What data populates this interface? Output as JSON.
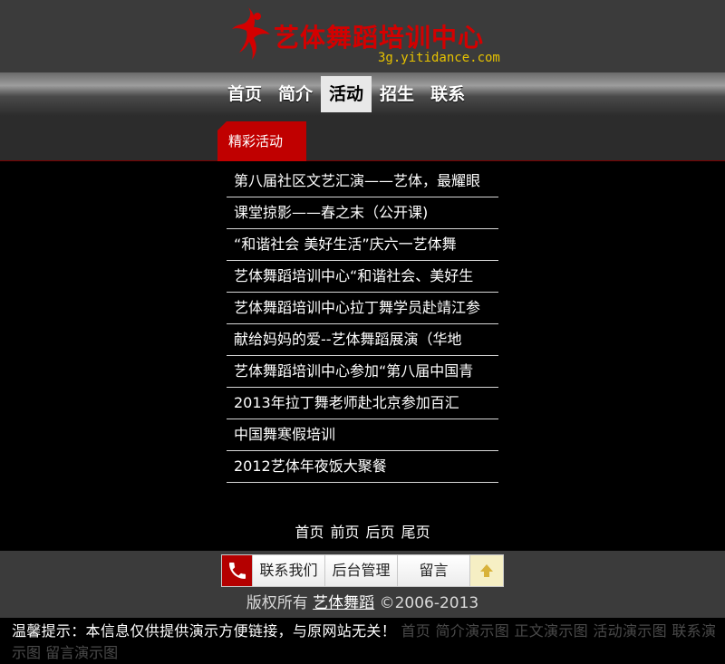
{
  "header": {
    "title": "艺体舞蹈培训中心",
    "url": "3g.yitidance.com"
  },
  "nav": {
    "items": [
      "首页",
      "简介",
      "活动",
      "招生",
      "联系"
    ],
    "active_index": 2
  },
  "section": {
    "title": "精彩活动"
  },
  "activities": [
    "第八届社区文艺汇演——艺体，最耀眼",
    "课堂掠影——春之末（公开课)",
    "“和谐社会 美好生活”庆六一艺体舞",
    "艺体舞蹈培训中心“和谐社会、美好生",
    "艺体舞蹈培训中心拉丁舞学员赴靖江参",
    "献给妈妈的爱--艺体舞蹈展演（华地",
    "艺体舞蹈培训中心参加“第八届中国青",
    "2013年拉丁舞老师赴北京参加百汇",
    "中国舞寒假培训",
    "2012艺体年夜饭大聚餐"
  ],
  "pager": {
    "first": "首页",
    "prev": "前页",
    "next": "后页",
    "last": "尾页"
  },
  "footer_tools": {
    "contact": "联系我们",
    "admin": "后台管理",
    "message": "留言"
  },
  "copyright": {
    "prefix": "版权所有",
    "brand": "艺体舞蹈",
    "years": "©2006-2013"
  },
  "notice": {
    "tip": "温馨提示：本信息仅供提供演示方便链接，与原网站无关！",
    "demo_links": [
      "首页",
      "简介演示图",
      "正文演示图",
      "活动演示图",
      "联系演示图",
      "留言演示图"
    ]
  },
  "colors": {
    "brand_red": "#d40000",
    "tab_red": "#c00000",
    "url_gold": "#e6c200",
    "dark_gray": "#3b3b3b"
  }
}
